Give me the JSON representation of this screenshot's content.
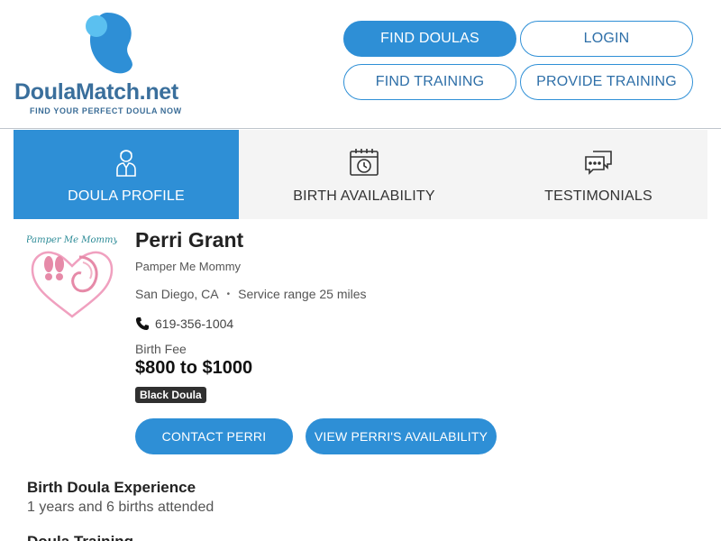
{
  "header": {
    "logo_part1": "Doula",
    "logo_part2": "Match.net",
    "logo_tagline": "FIND YOUR PERFECT DOULA NOW",
    "nav": {
      "find_doulas": "FIND DOULAS",
      "login": "LOGIN",
      "find_training": "FIND TRAINING",
      "provide_training": "PROVIDE TRAINING"
    }
  },
  "tabs": [
    {
      "label": "DOULA PROFILE",
      "icon": "person-icon",
      "active": true
    },
    {
      "label": "BIRTH AVAILABILITY",
      "icon": "calendar-clock-icon",
      "active": false
    },
    {
      "label": "TESTIMONIALS",
      "icon": "chat-bubbles-icon",
      "active": false
    }
  ],
  "profile": {
    "avatar_text": "Pamper Me Mommy",
    "name": "Perri Grant",
    "business": "Pamper Me Mommy",
    "city": "San Diego, CA",
    "dot": "•",
    "service_range": "Service range 25 miles",
    "phone": "619-356-1004",
    "fee_label": "Birth Fee",
    "fee_value": "$800 to $1000",
    "badge": "Black Doula",
    "contact_button": "CONTACT PERRI",
    "availability_button": "VIEW PERRI'S AVAILABILITY"
  },
  "sections": {
    "experience_title": "Birth Doula Experience",
    "experience_text": "1 years and 6 births attended",
    "training_title": "Doula Training"
  },
  "colors": {
    "primary": "#2e8fd6",
    "logo_blue": "#3a6f9c",
    "logo_light": "#5bc0f0"
  }
}
